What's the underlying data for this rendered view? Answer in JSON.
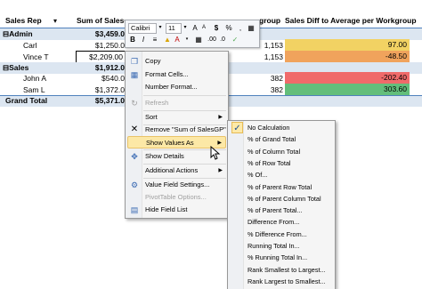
{
  "pivot": {
    "headers": {
      "sales_rep": "Sales Rep",
      "sum_sales": "Sum of SalesGP",
      "workgroup": "group",
      "diff": "Sales Diff to Average per Workgroup"
    },
    "rows": [
      {
        "rep": "⊟Admin",
        "sum": "$3,459.0",
        "avg": "",
        "diff": "",
        "bold": true
      },
      {
        "rep": "Carl",
        "sum": "$1,250.0",
        "avg": "1,153",
        "diff": "97.00",
        "diff_color": "#f2d263"
      },
      {
        "rep": "Vince T",
        "sum": "$2,209.00",
        "avg": "1,153",
        "diff": "-48.50",
        "diff_color": "#f0a35c"
      },
      {
        "rep": "⊟Sales",
        "sum": "$1,912.0",
        "avg": "",
        "diff": "",
        "bold": true
      },
      {
        "rep": "John A",
        "sum": "$540.0",
        "avg": "382",
        "diff": "-202.40",
        "diff_color": "#f06a6a"
      },
      {
        "rep": "Sam L",
        "sum": "$1,372.0",
        "avg": "382",
        "diff": "303.60",
        "diff_color": "#63be7b"
      },
      {
        "rep": "Grand Total",
        "sum": "$5,371.0",
        "avg": "",
        "diff": "",
        "bold": true
      }
    ]
  },
  "mini_toolbar": {
    "font_name": "Calibri",
    "font_size": "11",
    "bold": "B",
    "italic": "I",
    "currency": "$",
    "percent": "%",
    "comma": ","
  },
  "context_menu": {
    "items": [
      {
        "label": "Copy",
        "icon": "copy-icon"
      },
      {
        "label": "Format Cells...",
        "icon": "format-cells-icon"
      },
      {
        "label": "Number Format...",
        "icon": ""
      },
      {
        "label": "Refresh",
        "icon": "refresh-icon",
        "disabled": true
      },
      {
        "label": "Sort",
        "icon": "",
        "submenu": true
      },
      {
        "label": "Remove \"Sum of SalesGP\"",
        "icon": "remove-icon"
      },
      {
        "label": "Show Values As",
        "icon": "",
        "submenu": true,
        "highlighted": true
      },
      {
        "label": "Show Details",
        "icon": "show-details-icon"
      },
      {
        "label": "Additional Actions",
        "icon": "",
        "submenu": true
      },
      {
        "label": "Value Field Settings...",
        "icon": "value-field-settings-icon"
      },
      {
        "label": "PivotTable Options...",
        "icon": "",
        "disabled": true
      },
      {
        "label": "Hide Field List",
        "icon": "field-list-icon"
      }
    ]
  },
  "submenu": {
    "items": [
      {
        "label": "No Calculation",
        "checked": true
      },
      {
        "label": "% of Grand Total"
      },
      {
        "label": "% of Column Total"
      },
      {
        "label": "% of Row Total"
      },
      {
        "label": "% Of..."
      },
      {
        "label": "% of Parent Row Total"
      },
      {
        "label": "% of Parent Column Total"
      },
      {
        "label": "% of Parent Total..."
      },
      {
        "label": "Difference From..."
      },
      {
        "label": "% Difference From..."
      },
      {
        "label": "Running Total In..."
      },
      {
        "label": "% Running Total In..."
      },
      {
        "label": "Rank Smallest to Largest..."
      },
      {
        "label": "Rank Largest to Smallest..."
      }
    ]
  },
  "colors": {
    "header_line": "#4f81bd",
    "band": "#dce6f1",
    "menu_highlight": "#fce8a6"
  }
}
